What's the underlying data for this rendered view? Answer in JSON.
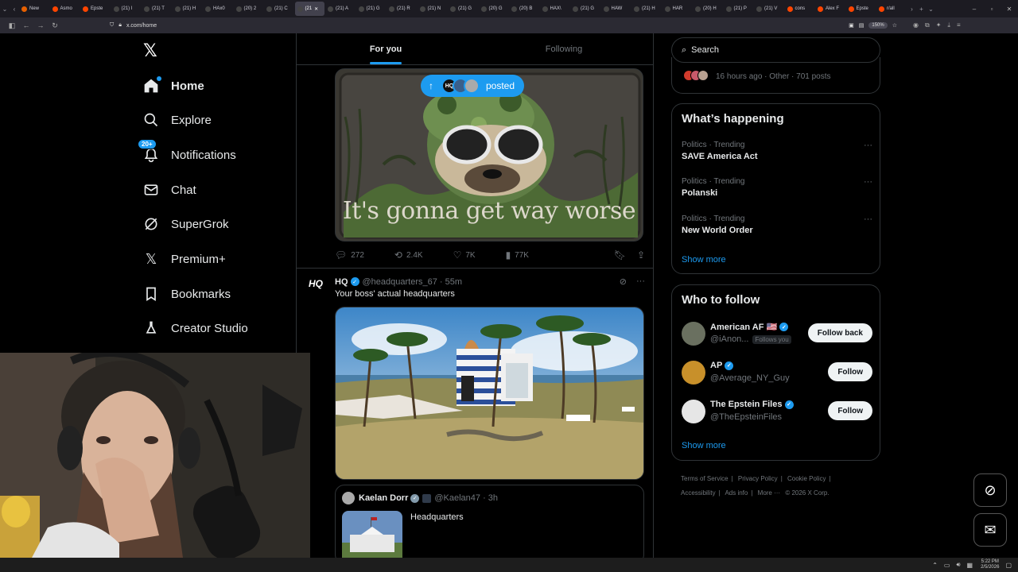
{
  "browser": {
    "tabs": [
      {
        "label": "New",
        "fav": "#e66000",
        "active": false
      },
      {
        "label": "Asmo",
        "fav": "#ff4500",
        "active": false
      },
      {
        "label": "Epste",
        "fav": "#ff4500",
        "active": false
      },
      {
        "label": "(21) I",
        "fav": "#444",
        "active": false
      },
      {
        "label": "(21) T",
        "fav": "#444",
        "active": false
      },
      {
        "label": "(21) H",
        "fav": "#444",
        "active": false
      },
      {
        "label": "HAx0",
        "fav": "#444",
        "active": false
      },
      {
        "label": "(20) 2",
        "fav": "#444",
        "active": false
      },
      {
        "label": "(21) C",
        "fav": "#444",
        "active": false
      },
      {
        "label": "(21",
        "fav": "#444",
        "active": true
      },
      {
        "label": "(21) A",
        "fav": "#444",
        "active": false
      },
      {
        "label": "(21) G",
        "fav": "#444",
        "active": false
      },
      {
        "label": "(21) R",
        "fav": "#444",
        "active": false
      },
      {
        "label": "(21) N",
        "fav": "#444",
        "active": false
      },
      {
        "label": "(21) G",
        "fav": "#444",
        "active": false
      },
      {
        "label": "(20) G",
        "fav": "#444",
        "active": false
      },
      {
        "label": "(20) B",
        "fav": "#444",
        "active": false
      },
      {
        "label": "HAX\\",
        "fav": "#444",
        "active": false
      },
      {
        "label": "(21) G",
        "fav": "#444",
        "active": false
      },
      {
        "label": "HAW",
        "fav": "#444",
        "active": false
      },
      {
        "label": "(21) H",
        "fav": "#444",
        "active": false
      },
      {
        "label": "HAR",
        "fav": "#444",
        "active": false
      },
      {
        "label": "(20) H",
        "fav": "#444",
        "active": false
      },
      {
        "label": "(21) P",
        "fav": "#444",
        "active": false
      },
      {
        "label": "(21) V",
        "fav": "#444",
        "active": false
      },
      {
        "label": "cons",
        "fav": "#ff4500",
        "active": false
      },
      {
        "label": "Alex F",
        "fav": "#ff4500",
        "active": false
      },
      {
        "label": "Epste",
        "fav": "#ff4500",
        "active": false
      },
      {
        "label": "r/all",
        "fav": "#ff4500",
        "active": false
      }
    ],
    "url": "x.com/home",
    "zoom": "150%"
  },
  "nav": {
    "items": [
      {
        "label": "Home",
        "icon": "home-icon"
      },
      {
        "label": "Explore",
        "icon": "search-icon"
      },
      {
        "label": "Notifications",
        "icon": "bell-icon",
        "badge": "20+"
      },
      {
        "label": "Chat",
        "icon": "mail-icon"
      },
      {
        "label": "SuperGrok",
        "icon": "grok-icon"
      },
      {
        "label": "Premium+",
        "icon": "x-icon"
      },
      {
        "label": "Bookmarks",
        "icon": "bookmark-icon"
      },
      {
        "label": "Creator Studio",
        "icon": "flask-icon"
      }
    ]
  },
  "feed": {
    "tabs": [
      "For you",
      "Following"
    ],
    "posted_pill": {
      "label": "posted",
      "avatar_text": "HQ"
    },
    "patch_text": "It's gonna get way worse",
    "tweet1_actions": {
      "replies": "272",
      "reposts": "2.4K",
      "likes": "7K",
      "views": "77K"
    },
    "tweet2": {
      "avatar": "HQ",
      "name": "HQ",
      "handle": "@headquarters_67",
      "time": "· 55m",
      "text": "Your boss' actual headquarters",
      "quote": {
        "name": "Kaelan Dorr",
        "handle": "@Kaelan47",
        "time": "· 3h",
        "text": "Headquarters"
      }
    }
  },
  "sidebar": {
    "search_placeholder": "Search",
    "prev_meta": "16 hours ago · Other · 701 posts",
    "happening": {
      "title": "What’s happening",
      "trends": [
        {
          "category": "Politics · Trending",
          "name": "SAVE America Act"
        },
        {
          "category": "Politics · Trending",
          "name": "Polanski"
        },
        {
          "category": "Politics · Trending",
          "name": "New World Order"
        }
      ],
      "show_more": "Show more"
    },
    "who_to_follow": {
      "title": "Who to follow",
      "accounts": [
        {
          "name": "American AF 🇺🇸",
          "handle": "@iAnon...",
          "follows_you": "Follows you",
          "button": "Follow back"
        },
        {
          "name": "AP",
          "handle": "@Average_NY_Guy",
          "follows_you": "",
          "button": "Follow"
        },
        {
          "name": "The Epstein Files",
          "handle": "@TheEpsteinFiles",
          "follows_you": "",
          "button": "Follow"
        }
      ],
      "show_more": "Show more"
    },
    "footer": {
      "links": [
        "Terms of Service",
        "|",
        "Privacy Policy",
        "|",
        "Cookie Policy",
        "|",
        "Accessibility",
        "|",
        "Ads info",
        "|",
        "More ···",
        "© 2026 X Corp."
      ]
    }
  },
  "taskbar": {
    "time": "5:22 PM",
    "date": "2/5/2026"
  }
}
